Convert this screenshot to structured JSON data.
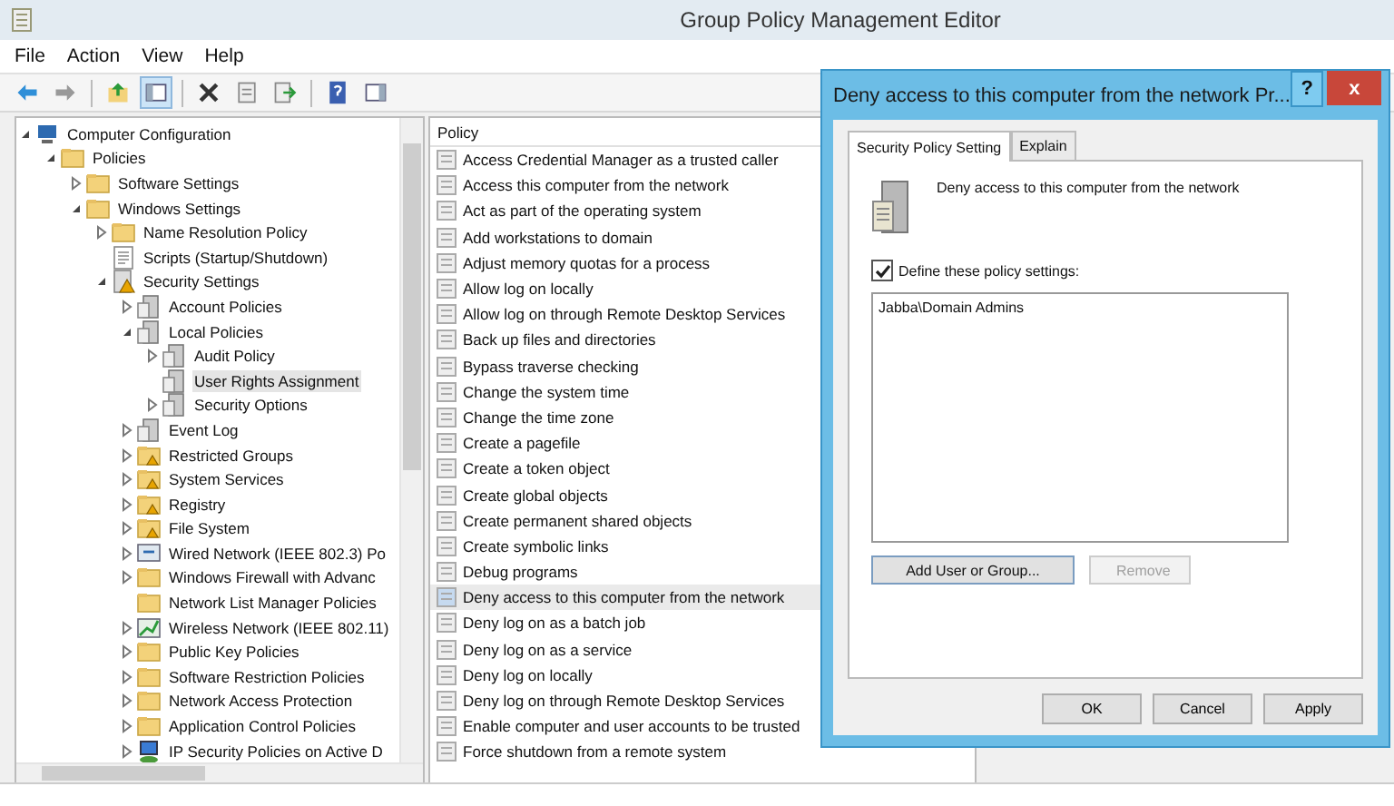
{
  "window": {
    "title": "Group Policy Management Editor"
  },
  "menu": [
    {
      "label": "File"
    },
    {
      "label": "Action"
    },
    {
      "label": "View"
    },
    {
      "label": "Help"
    }
  ],
  "toolbar": [
    {
      "kind": "back"
    },
    {
      "kind": "forward"
    },
    {
      "kind": "sep"
    },
    {
      "kind": "up"
    },
    {
      "kind": "pane",
      "selected": true
    },
    {
      "kind": "sep"
    },
    {
      "kind": "delete"
    },
    {
      "kind": "properties"
    },
    {
      "kind": "export"
    },
    {
      "kind": "sep"
    },
    {
      "kind": "help"
    },
    {
      "kind": "pane2"
    }
  ],
  "tree": [
    {
      "label": "Computer Configuration",
      "kind": "computer",
      "expanded": true,
      "selected": false,
      "children": [
        {
          "label": "Policies",
          "kind": "folder",
          "expanded": true,
          "selected": false,
          "children": [
            {
              "label": "Software Settings",
              "kind": "folder",
              "expanded": false,
              "selected": false
            },
            {
              "label": "Windows Settings",
              "kind": "folder",
              "expanded": true,
              "selected": false,
              "children": [
                {
                  "label": "Name Resolution Policy",
                  "kind": "folder",
                  "expanded": false,
                  "selected": false
                },
                {
                  "label": "Scripts (Startup/Shutdown)",
                  "kind": "script",
                  "selected": false
                },
                {
                  "label": "Security Settings",
                  "kind": "secure",
                  "expanded": true,
                  "selected": false,
                  "children": [
                    {
                      "label": "Account Policies",
                      "kind": "policy",
                      "expanded": false,
                      "selected": false
                    },
                    {
                      "label": "Local Policies",
                      "kind": "policy",
                      "expanded": true,
                      "selected": false,
                      "children": [
                        {
                          "label": "Audit Policy",
                          "kind": "policy",
                          "expanded": false,
                          "selected": false
                        },
                        {
                          "label": "User Rights Assignment",
                          "kind": "policy",
                          "selected": true
                        },
                        {
                          "label": "Security Options",
                          "kind": "policy",
                          "expanded": false,
                          "selected": false
                        }
                      ]
                    },
                    {
                      "label": "Event Log",
                      "kind": "policy",
                      "expanded": false,
                      "selected": false
                    },
                    {
                      "label": "Restricted Groups",
                      "kind": "securefolder",
                      "expanded": false,
                      "selected": false
                    },
                    {
                      "label": "System Services",
                      "kind": "securefolder",
                      "expanded": false,
                      "selected": false
                    },
                    {
                      "label": "Registry",
                      "kind": "securefolder",
                      "expanded": false,
                      "selected": false
                    },
                    {
                      "label": "File System",
                      "kind": "securefolder",
                      "expanded": false,
                      "selected": false
                    },
                    {
                      "label": "Wired Network (IEEE 802.3) Po",
                      "kind": "network",
                      "expanded": false,
                      "selected": false
                    },
                    {
                      "label": "Windows Firewall with Advanc",
                      "kind": "folder",
                      "expanded": false,
                      "selected": false
                    },
                    {
                      "label": "Network List Manager Policies",
                      "kind": "folder",
                      "selected": false
                    },
                    {
                      "label": "Wireless Network (IEEE 802.11)",
                      "kind": "chart",
                      "expanded": false,
                      "selected": false
                    },
                    {
                      "label": "Public Key Policies",
                      "kind": "folder",
                      "expanded": false,
                      "selected": false
                    },
                    {
                      "label": "Software Restriction Policies",
                      "kind": "folder",
                      "expanded": false,
                      "selected": false
                    },
                    {
                      "label": "Network Access Protection",
                      "kind": "folder",
                      "expanded": false,
                      "selected": false
                    },
                    {
                      "label": "Application Control Policies",
                      "kind": "folder",
                      "expanded": false,
                      "selected": false
                    },
                    {
                      "label": "IP Security Policies on Active D",
                      "kind": "monitor",
                      "expanded": false,
                      "selected": false
                    }
                  ]
                }
              ]
            }
          ]
        }
      ]
    }
  ],
  "list": {
    "column": "Policy",
    "rows": [
      {
        "label": "Access Credential Manager as a trusted caller",
        "selected": false
      },
      {
        "label": "Access this computer from the network",
        "selected": false
      },
      {
        "label": "Act as part of the operating system",
        "selected": false
      },
      {
        "label": "Add workstations to domain",
        "selected": false
      },
      {
        "label": "Adjust memory quotas for a process",
        "selected": false
      },
      {
        "label": "Allow log on locally",
        "selected": false
      },
      {
        "label": "Allow log on through Remote Desktop Services",
        "selected": false
      },
      {
        "label": "Back up files and directories",
        "selected": false
      },
      {
        "label": "Bypass traverse checking",
        "selected": false
      },
      {
        "label": "Change the system time",
        "selected": false
      },
      {
        "label": "Change the time zone",
        "selected": false
      },
      {
        "label": "Create a pagefile",
        "selected": false
      },
      {
        "label": "Create a token object",
        "selected": false
      },
      {
        "label": "Create global objects",
        "selected": false
      },
      {
        "label": "Create permanent shared objects",
        "selected": false
      },
      {
        "label": "Create symbolic links",
        "selected": false
      },
      {
        "label": "Debug programs",
        "selected": false
      },
      {
        "label": "Deny access to this computer from the network",
        "selected": true
      },
      {
        "label": "Deny log on as a batch job",
        "selected": false
      },
      {
        "label": "Deny log on as a service",
        "selected": false
      },
      {
        "label": "Deny log on locally",
        "selected": false
      },
      {
        "label": "Deny log on through Remote Desktop Services",
        "selected": false
      },
      {
        "label": "Enable computer and user accounts to be trusted",
        "selected": false
      },
      {
        "label": "Force shutdown from a remote system",
        "selected": false
      }
    ]
  },
  "dialog": {
    "title": "Deny access to this computer from the network Pr...",
    "help": "?",
    "close": "x",
    "tabs": [
      {
        "label": "Security Policy Setting",
        "selected": true
      },
      {
        "label": "Explain",
        "selected": false
      }
    ],
    "heading": "Deny access to this computer from the network",
    "define": {
      "label": "Define these policy settings:",
      "checked": true
    },
    "members": [
      "Jabba\\Domain Admins"
    ],
    "actions": [
      {
        "label": "Add User or Group...",
        "disabled": false
      },
      {
        "label": "Remove",
        "disabled": true
      }
    ],
    "buttons": [
      "OK",
      "Cancel",
      "Apply"
    ]
  }
}
